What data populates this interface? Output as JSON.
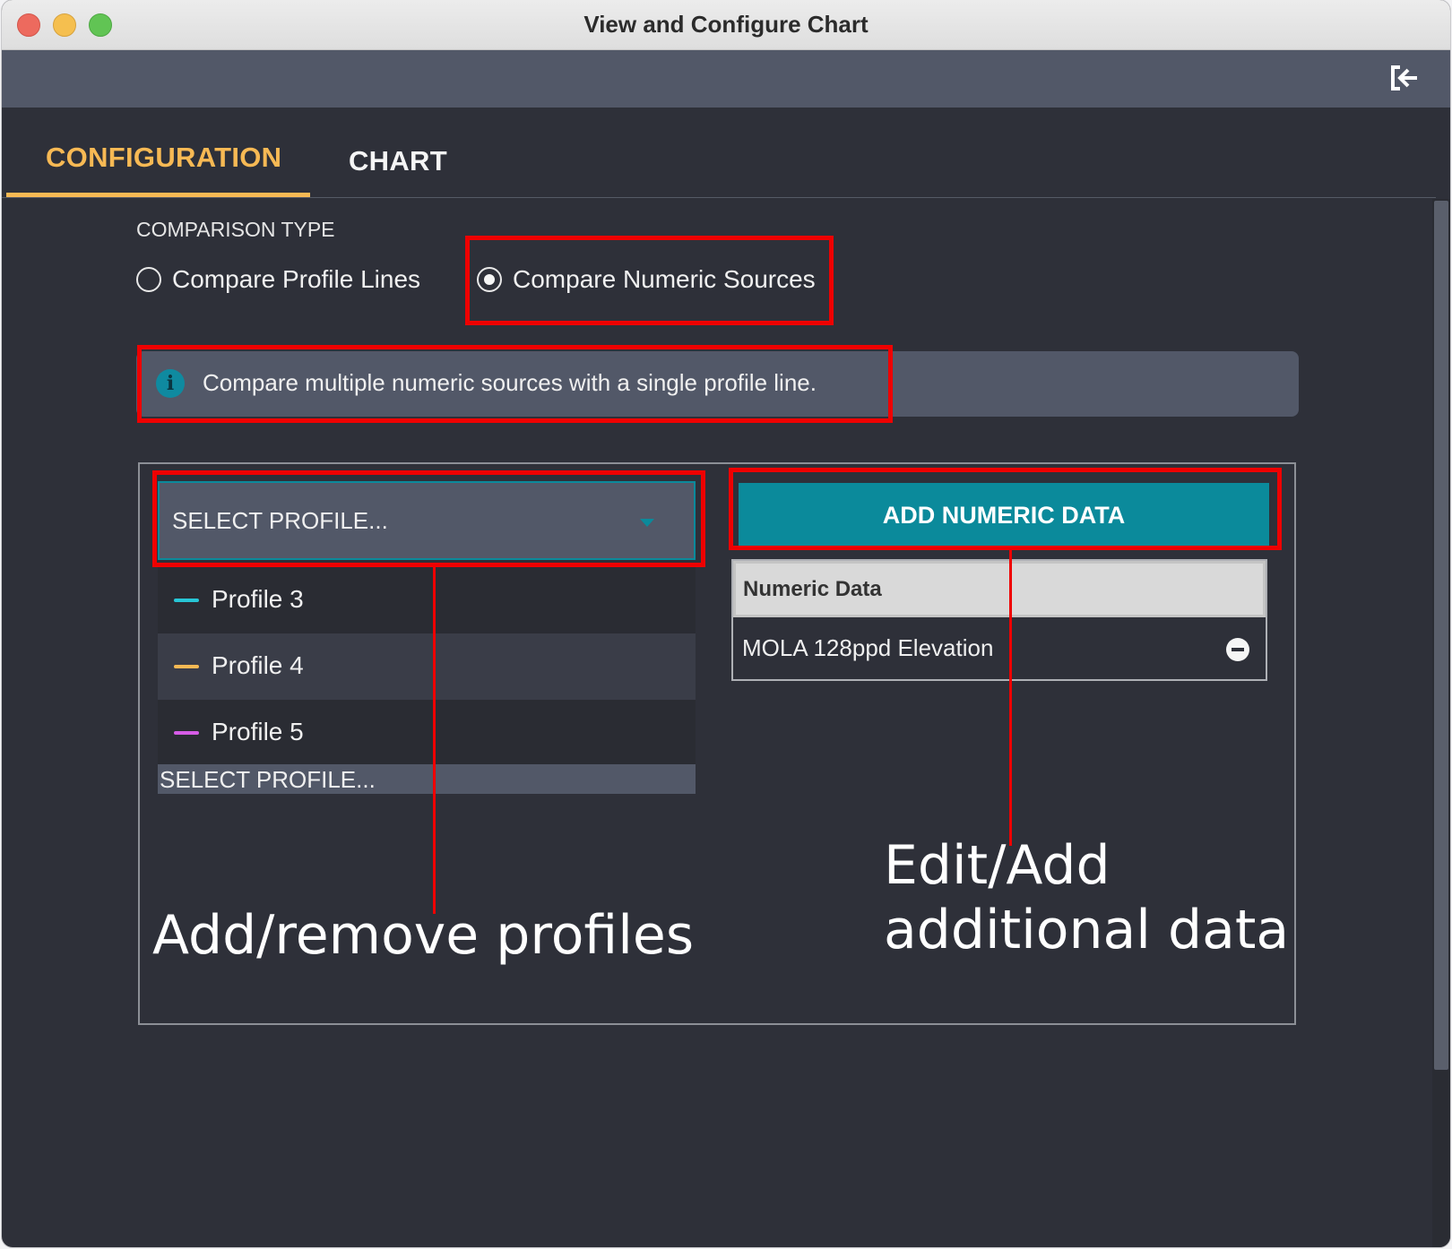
{
  "window": {
    "title": "View and Configure Chart"
  },
  "toolbar": {
    "exit_icon": "exit-icon"
  },
  "tabs": [
    {
      "label": "CONFIGURATION",
      "active": true
    },
    {
      "label": "CHART",
      "active": false
    }
  ],
  "comparison": {
    "label": "COMPARISON TYPE",
    "options": [
      {
        "label": "Compare Profile Lines",
        "checked": false
      },
      {
        "label": "Compare Numeric Sources",
        "checked": true
      }
    ]
  },
  "info": {
    "icon": "info-icon",
    "text": "Compare multiple numeric sources with a single profile line."
  },
  "profile_select": {
    "value": "SELECT PROFILE...",
    "options": [
      {
        "label": "Profile 3",
        "color": "#27c6d6"
      },
      {
        "label": "Profile 4",
        "color": "#f7b954"
      },
      {
        "label": "Profile 5",
        "color": "#d65ce6"
      }
    ],
    "footer": "SELECT PROFILE..."
  },
  "numeric": {
    "add_button": "ADD NUMERIC DATA",
    "table_header": "Numeric Data",
    "rows": [
      {
        "name": "MOLA 128ppd Elevation"
      }
    ]
  },
  "annotations": {
    "left": "Add/remove profiles",
    "right": "Edit/Add additional data"
  },
  "colors": {
    "accent": "#f7b954",
    "teal": "#0b8a9b",
    "highlight": "#ef0000"
  }
}
